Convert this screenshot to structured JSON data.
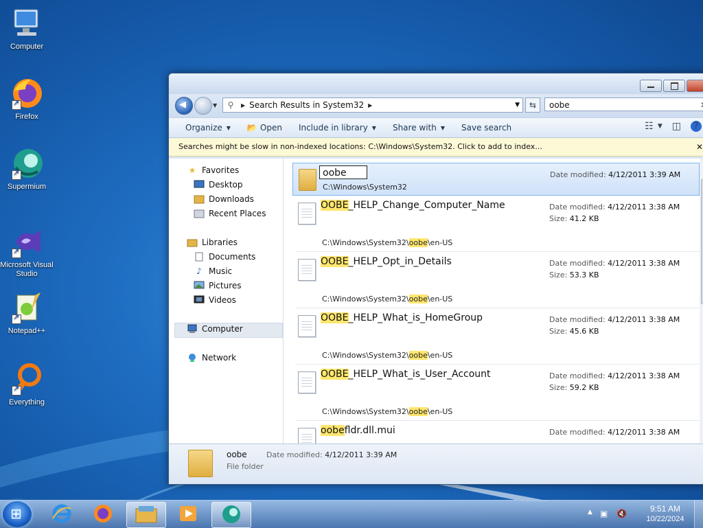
{
  "desktop": {
    "icons": [
      {
        "label": "Computer",
        "icon": "computer-icon"
      },
      {
        "label": "Firefox",
        "icon": "firefox-icon"
      },
      {
        "label": "Supermium",
        "icon": "supermium-icon"
      },
      {
        "label": "Microsoft Visual Studio",
        "icon": "visual-studio-icon"
      },
      {
        "label": "Notepad++",
        "icon": "notepadpp-icon"
      },
      {
        "label": "Everything",
        "icon": "everything-icon"
      }
    ]
  },
  "explorer": {
    "address": {
      "path": "Search Results in System32"
    },
    "search": {
      "value": "oobe"
    },
    "toolbar": {
      "organize": "Organize",
      "open": "Open",
      "include_in_library": "Include in library",
      "share_with": "Share with",
      "save_search": "Save search"
    },
    "infobar": "Searches might be slow in non-indexed locations: C:\\Windows\\System32. Click to add to index...",
    "nav": {
      "favorites": "Favorites",
      "desktop": "Desktop",
      "downloads": "Downloads",
      "recent_places": "Recent Places",
      "libraries": "Libraries",
      "documents": "Documents",
      "music": "Music",
      "pictures": "Pictures",
      "videos": "Videos",
      "computer": "Computer",
      "network": "Network"
    },
    "labels": {
      "date_modified": "Date modified:",
      "size": "Size:"
    },
    "results": [
      {
        "rename_value": "oobe",
        "path": "C:\\Windows\\System32",
        "date": "4/12/2011 3:39 AM"
      },
      {
        "hl": "OOBE",
        "rest": "_HELP_Change_Computer_Name",
        "date": "4/12/2011 3:38 AM",
        "size": "41.2 KB",
        "path_pre": "C:\\Windows\\System32\\",
        "path_hl": "oobe",
        "path_post": "\\en-US"
      },
      {
        "hl": "OOBE",
        "rest": "_HELP_Opt_in_Details",
        "date": "4/12/2011 3:38 AM",
        "size": "53.3 KB",
        "path_pre": "C:\\Windows\\System32\\",
        "path_hl": "oobe",
        "path_post": "\\en-US"
      },
      {
        "hl": "OOBE",
        "rest": "_HELP_What_is_HomeGroup",
        "date": "4/12/2011 3:38 AM",
        "size": "45.6 KB",
        "path_pre": "C:\\Windows\\System32\\",
        "path_hl": "oobe",
        "path_post": "\\en-US"
      },
      {
        "hl": "OOBE",
        "rest": "_HELP_What_is_User_Account",
        "date": "4/12/2011 3:38 AM",
        "size": "59.2 KB",
        "path_pre": "C:\\Windows\\System32\\",
        "path_hl": "oobe",
        "path_post": "\\en-US"
      },
      {
        "hl": "oobe",
        "rest": "fldr.dll.mui",
        "date": "4/12/2011 3:38 AM"
      }
    ],
    "details": {
      "name": "oobe",
      "date_label": "Date modified:",
      "date": "4/12/2011 3:39 AM",
      "type": "File folder"
    }
  },
  "taskbar": {
    "clock": {
      "time": "9:51 AM",
      "date": "10/22/2024"
    }
  },
  "colors": {
    "highlight": "#ffe66d",
    "selection": "#cfe2f9",
    "infobar": "#fdf9d6"
  }
}
